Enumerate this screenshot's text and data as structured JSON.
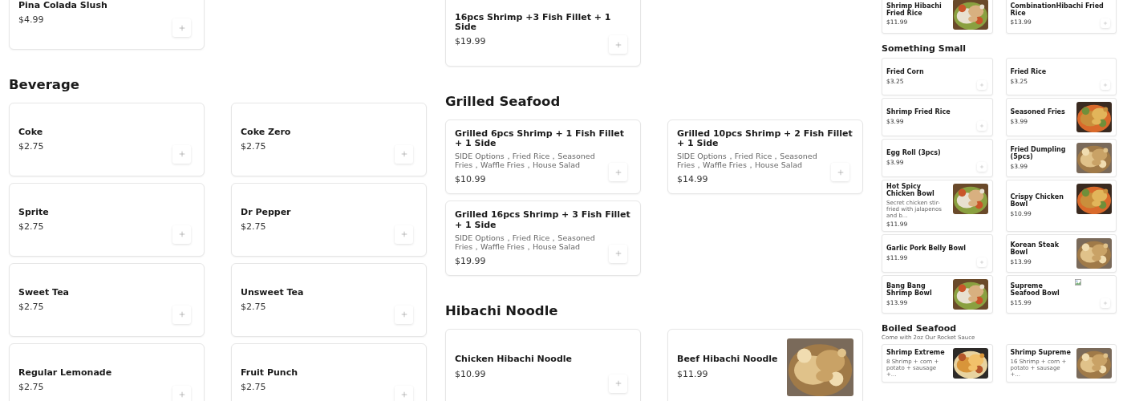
{
  "columns": [
    {
      "sections": [
        {
          "items": [
            {
              "name": "Pina Colada Slush",
              "price": "$4.99",
              "kind": "plain"
            }
          ]
        },
        {
          "title": "Beverage",
          "items": [
            {
              "name": "Coke",
              "price": "$2.75",
              "kind": "plain"
            },
            {
              "name": "Coke Zero",
              "price": "$2.75",
              "kind": "plain"
            },
            {
              "name": "Sprite",
              "price": "$2.75",
              "kind": "plain"
            },
            {
              "name": "Dr Pepper",
              "price": "$2.75",
              "kind": "plain"
            },
            {
              "name": "Sweet Tea",
              "price": "$2.75",
              "kind": "plain"
            },
            {
              "name": "Unsweet Tea",
              "price": "$2.75",
              "kind": "plain"
            },
            {
              "name": "Regular Lemonade",
              "price": "$2.75",
              "kind": "plain"
            },
            {
              "name": "Fruit Punch",
              "price": "$2.75",
              "kind": "plain"
            }
          ]
        }
      ]
    },
    {
      "sections": [
        {
          "items": [
            {
              "name": "16pcs Shrimp +3 Fish Fillet + 1 Side",
              "price": "$19.99",
              "kind": "plain"
            }
          ]
        },
        {
          "title": "Grilled Seafood",
          "items": [
            {
              "name": "Grilled 6pcs Shrimp + 1 Fish Fillet + 1 Side",
              "description": "SIDE Options，Fried Rice，Seasoned Fries，Waffle Fries，House Salad",
              "price": "$10.99",
              "kind": "plain"
            },
            {
              "name": "Grilled 10pcs Shrimp + 2 Fish Fillet + 1 Side",
              "description": "SIDE Options，Fried Rice，Seasoned Fries，Waffle Fries，House Salad",
              "price": "$14.99",
              "kind": "plain"
            },
            {
              "name": "Grilled 16pcs Shrimp + 3 Fish Fillet + 1 Side",
              "description": "SIDE Options，Fried Rice，Seasoned Fries，Waffle Fries，House Salad",
              "price": "$19.99",
              "kind": "plain"
            }
          ]
        },
        {
          "title": "Hibachi Noodle",
          "items": [
            {
              "name": "Chicken Hibachi Noodle",
              "price": "$10.99",
              "kind": "plain"
            },
            {
              "name": "Beef Hibachi Noodle",
              "price": "$11.99"
            }
          ]
        }
      ]
    },
    {
      "sections": [
        {
          "items": [
            {
              "name": "Shrimp Hibachi Fried Rice",
              "price": "$11.99"
            },
            {
              "name": "CombinationHibachi Fried Rice",
              "price": "$13.99",
              "kind": "plain"
            }
          ]
        },
        {
          "title": "Something Small",
          "items": [
            {
              "name": "Fried Corn",
              "price": "$3.25",
              "kind": "plain"
            },
            {
              "name": "Fried Rice",
              "price": "$3.25",
              "kind": "plain"
            },
            {
              "name": "Shrimp Fried Rice",
              "price": "$3.99",
              "kind": "plain"
            },
            {
              "name": "Seasoned Fries",
              "price": "$3.99"
            },
            {
              "name": "Egg Roll (3pcs)",
              "price": "$3.99",
              "kind": "plain"
            },
            {
              "name": "Fried Dumpling (5pcs)",
              "price": "$3.99"
            },
            {
              "name": "Hot Spicy Chicken Bowl",
              "description": "Secret chicken stir-fried with jalapenos and b...",
              "price": "$11.99"
            },
            {
              "name": "Crispy Chicken Bowl",
              "price": "$10.99"
            },
            {
              "name": "Garlic Pork Belly Bowl",
              "price": "$11.99",
              "kind": "plain"
            },
            {
              "name": "Korean Steak Bowl",
              "price": "$13.99"
            },
            {
              "name": "Bang Bang Shrimp Bowl",
              "price": "$13.99"
            },
            {
              "name": "Supreme Seafood Bowl",
              "price": "$15.99",
              "kind": "broken"
            }
          ]
        },
        {
          "title": "Boiled Seafood",
          "subtitle": "Come with 2oz Our Rocket Sauce",
          "items": [
            {
              "name": "Shrimp Extreme",
              "description": "8 Shrimp + corn + potato + sausage +..."
            },
            {
              "name": "Shrimp Supreme",
              "description": "16 Shrimp + corn + potato + sausage +..."
            }
          ]
        }
      ]
    }
  ]
}
